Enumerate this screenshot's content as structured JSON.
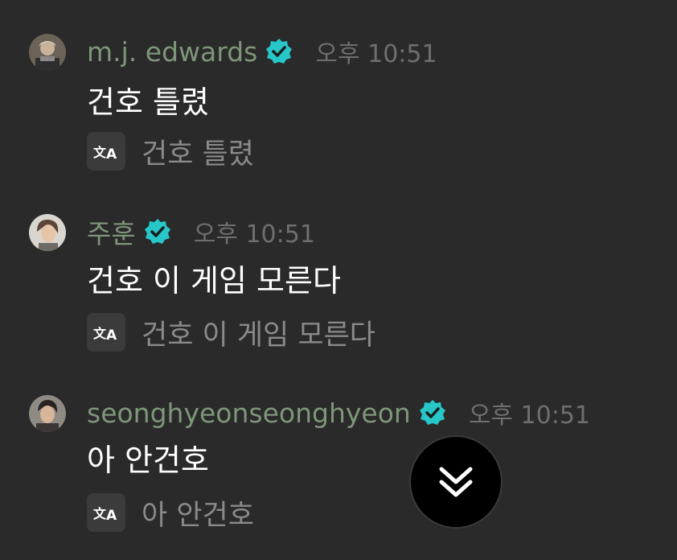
{
  "colors": {
    "background": "#2a2a2a",
    "username": "#7e9679",
    "timestamp": "#6f6f6f",
    "message_text": "#ffffff",
    "translated_text": "#8a8a8a",
    "verified_badge": "#26c6c9",
    "translate_button_bg": "#3b3b3b",
    "scroll_button_bg": "#000000"
  },
  "messages": [
    {
      "username": "m.j. edwards",
      "verified": true,
      "time": "오후 10:51",
      "text": "건호 틀렸",
      "translated": "건호 틀렸",
      "avatar_icon": "avatar-photo"
    },
    {
      "username": "주훈",
      "verified": true,
      "time": "오후 10:51",
      "text": "건호 이 게임 모른다",
      "translated": "건호 이 게임 모른다",
      "avatar_icon": "avatar-photo"
    },
    {
      "username": "seonghyeonseonghyeon",
      "verified": true,
      "time": "오후 10:51",
      "text": "아 안건호",
      "translated": "아 안건호",
      "avatar_icon": "avatar-photo"
    }
  ],
  "icons": {
    "translate": "translate-icon",
    "verified": "verified-badge-icon",
    "scroll_down": "double-chevron-down-icon"
  }
}
